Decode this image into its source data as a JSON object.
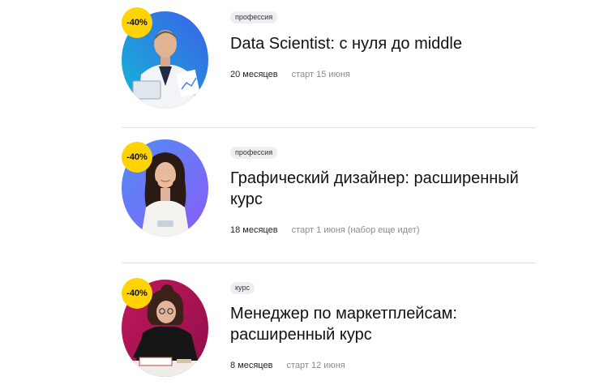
{
  "courses": [
    {
      "discount": "-40%",
      "tag": "профессия",
      "title": "Data Scientist: с нуля до middle",
      "duration": "20 месяцев",
      "start": "старт 15 июня",
      "photo_colors": [
        "#14b8d6",
        "#3b5fe8"
      ]
    },
    {
      "discount": "-40%",
      "tag": "профессия",
      "title": "Графический дизайнер: расширенный курс",
      "duration": "18 месяцев",
      "start": "старт 1 июня (набор еще идет)",
      "photo_colors": [
        "#4f8ef7",
        "#8a5cf6"
      ]
    },
    {
      "discount": "-40%",
      "tag": "курс",
      "title": "Менеджер по маркетплейсам: расширенный курс",
      "duration": "8 месяцев",
      "start": "старт 12 июня",
      "photo_colors": [
        "#c2185b",
        "#8e0e4a"
      ]
    }
  ],
  "colors": {
    "discount_badge": "#ffd400",
    "tag_background": "#eceef1",
    "muted_text": "#8a8a8a",
    "divider": "#e2e2e2"
  }
}
